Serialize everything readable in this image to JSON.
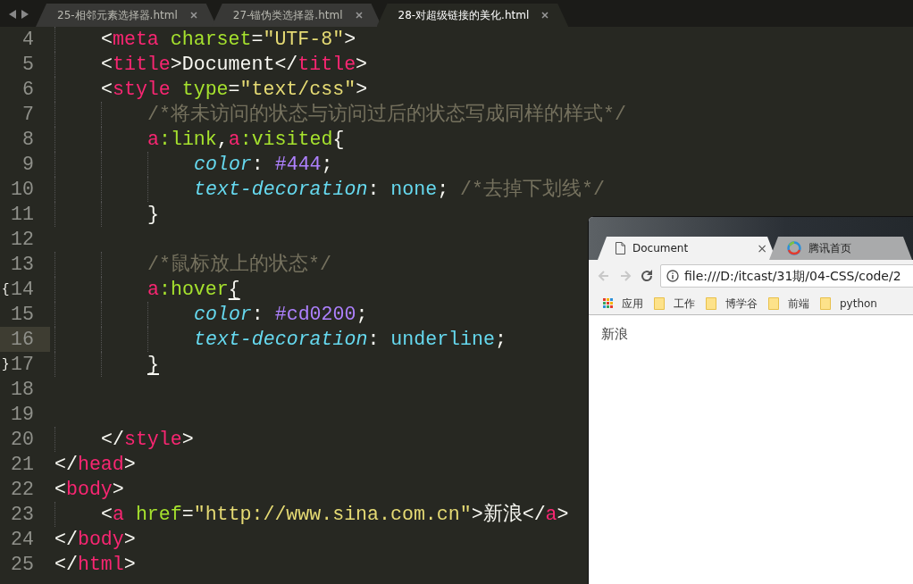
{
  "editor_tabs": [
    {
      "label": "25-相邻元素选择器.html",
      "selected": false
    },
    {
      "label": "27-锚伪类选择器.html",
      "selected": false
    },
    {
      "label": "28-对超级链接的美化.html",
      "selected": true
    }
  ],
  "code_lines": [
    {
      "number": "4",
      "current": false,
      "tokens": [
        {
          "text": "    <",
          "kind": "punct"
        },
        {
          "text": "meta",
          "kind": "tag"
        },
        {
          "text": " charset",
          "kind": "attr"
        },
        {
          "text": "=",
          "kind": "punct"
        },
        {
          "text": "\"UTF-8\"",
          "kind": "string"
        },
        {
          "text": ">",
          "kind": "punct"
        }
      ]
    },
    {
      "number": "5",
      "current": false,
      "tokens": [
        {
          "text": "    <",
          "kind": "punct"
        },
        {
          "text": "title",
          "kind": "tag"
        },
        {
          "text": ">Document</",
          "kind": "punct"
        },
        {
          "text": "title",
          "kind": "tag"
        },
        {
          "text": ">",
          "kind": "punct"
        }
      ]
    },
    {
      "number": "6",
      "current": false,
      "tokens": [
        {
          "text": "    <",
          "kind": "punct"
        },
        {
          "text": "style",
          "kind": "tag"
        },
        {
          "text": " type",
          "kind": "attr"
        },
        {
          "text": "=",
          "kind": "punct"
        },
        {
          "text": "\"text/css\"",
          "kind": "string"
        },
        {
          "text": ">",
          "kind": "punct"
        }
      ]
    },
    {
      "number": "7",
      "current": false,
      "tokens": [
        {
          "text": "        /*将未访问的状态与访问过后的状态写成同样的样式*/",
          "kind": "comment"
        }
      ]
    },
    {
      "number": "8",
      "current": false,
      "tokens": [
        {
          "text": "        a",
          "kind": "tag"
        },
        {
          "text": ":link",
          "kind": "attr"
        },
        {
          "text": ",",
          "kind": "punct"
        },
        {
          "text": "a",
          "kind": "tag"
        },
        {
          "text": ":visited",
          "kind": "attr"
        },
        {
          "text": "{",
          "kind": "punct"
        }
      ]
    },
    {
      "number": "9",
      "current": false,
      "tokens": [
        {
          "text": "            color",
          "kind": "prop"
        },
        {
          "text": ": ",
          "kind": "punct"
        },
        {
          "text": "#444",
          "kind": "number"
        },
        {
          "text": ";",
          "kind": "punct"
        }
      ]
    },
    {
      "number": "10",
      "current": false,
      "tokens": [
        {
          "text": "            text-decoration",
          "kind": "prop"
        },
        {
          "text": ": ",
          "kind": "punct"
        },
        {
          "text": "none",
          "kind": "value"
        },
        {
          "text": "; ",
          "kind": "punct"
        },
        {
          "text": "/*去掉下划线*/",
          "kind": "comment"
        }
      ]
    },
    {
      "number": "11",
      "current": false,
      "tokens": [
        {
          "text": "        }",
          "kind": "punct"
        }
      ]
    },
    {
      "number": "12",
      "current": false
    },
    {
      "number": "13",
      "current": false,
      "tokens": [
        {
          "text": "        /*鼠标放上的状态*/",
          "kind": "comment"
        }
      ]
    },
    {
      "number": "14",
      "current": false,
      "gutter_mark": "{",
      "tokens": [
        {
          "text": "        a",
          "kind": "tag"
        },
        {
          "text": ":hover",
          "kind": "attr"
        },
        {
          "text": "{",
          "kind": "bracket"
        }
      ]
    },
    {
      "number": "15",
      "current": false,
      "tokens": [
        {
          "text": "            color",
          "kind": "prop"
        },
        {
          "text": ": ",
          "kind": "punct"
        },
        {
          "text": "#cd0200",
          "kind": "number"
        },
        {
          "text": ";",
          "kind": "punct"
        }
      ]
    },
    {
      "number": "16",
      "current": true,
      "tokens": [
        {
          "text": "            text-decoration",
          "kind": "prop"
        },
        {
          "text": ": ",
          "kind": "punct"
        },
        {
          "text": "underline",
          "kind": "value"
        },
        {
          "text": ";",
          "kind": "punct"
        }
      ]
    },
    {
      "number": "17",
      "current": false,
      "gutter_mark": "}",
      "tokens": [
        {
          "text": "        }",
          "kind": "bracket"
        }
      ]
    },
    {
      "number": "18",
      "current": false
    },
    {
      "number": "19",
      "current": false
    },
    {
      "number": "20",
      "current": false,
      "tokens": [
        {
          "text": "    </",
          "kind": "punct"
        },
        {
          "text": "style",
          "kind": "tag"
        },
        {
          "text": ">",
          "kind": "punct"
        }
      ]
    },
    {
      "number": "21",
      "current": false,
      "tokens": [
        {
          "text": "</",
          "kind": "punct"
        },
        {
          "text": "head",
          "kind": "tag"
        },
        {
          "text": ">",
          "kind": "punct"
        }
      ]
    },
    {
      "number": "22",
      "current": false,
      "tokens": [
        {
          "text": "<",
          "kind": "punct"
        },
        {
          "text": "body",
          "kind": "tag"
        },
        {
          "text": ">",
          "kind": "punct"
        }
      ]
    },
    {
      "number": "23",
      "current": false,
      "tokens": [
        {
          "text": "    <",
          "kind": "punct"
        },
        {
          "text": "a",
          "kind": "tag"
        },
        {
          "text": " href",
          "kind": "attr"
        },
        {
          "text": "=",
          "kind": "punct"
        },
        {
          "text": "\"http://www.sina.com.cn\"",
          "kind": "string"
        },
        {
          "text": ">新浪</",
          "kind": "punct"
        },
        {
          "text": "a",
          "kind": "tag"
        },
        {
          "text": ">",
          "kind": "punct"
        }
      ]
    },
    {
      "number": "24",
      "current": false,
      "tokens": [
        {
          "text": "</",
          "kind": "punct"
        },
        {
          "text": "body",
          "kind": "tag"
        },
        {
          "text": ">",
          "kind": "punct"
        }
      ]
    },
    {
      "number": "25",
      "current": false,
      "tokens": [
        {
          "text": "</",
          "kind": "punct"
        },
        {
          "text": "html",
          "kind": "tag"
        },
        {
          "text": ">",
          "kind": "punct"
        }
      ]
    }
  ],
  "browser": {
    "tabs": [
      {
        "label": "Document",
        "selected": true,
        "close": "×"
      },
      {
        "label": "腾讯首页",
        "selected": false
      }
    ],
    "address": "file:///D:/itcast/31期/04-CSS/code/2",
    "bookmarks": [
      {
        "label": "应用",
        "kind": "apps"
      },
      {
        "label": "工作",
        "kind": "folder"
      },
      {
        "label": "博学谷",
        "kind": "folder"
      },
      {
        "label": "前端",
        "kind": "folder"
      },
      {
        "label": "python",
        "kind": "folder"
      }
    ],
    "page_link": "新浪"
  }
}
